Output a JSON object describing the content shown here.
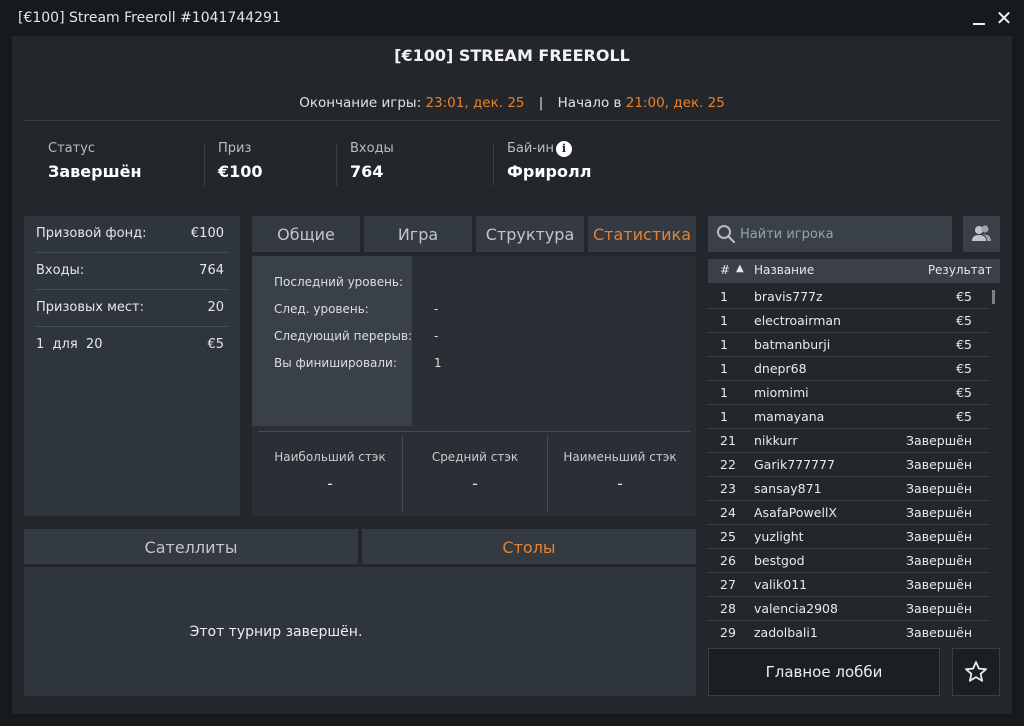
{
  "window": {
    "title": "[€100] Stream Freeroll #1041744291",
    "close": "✕"
  },
  "header": {
    "title": "[€100] STREAM FREEROLL",
    "end_label": "Окончание игры:",
    "end_value": "23:01, дек. 25",
    "separator": "|",
    "start_label": "Начало в",
    "start_value": "21:00, дек. 25"
  },
  "summary": {
    "status_label": "Статус",
    "status_value": "Завершён",
    "prize_label": "Приз",
    "prize_value": "€100",
    "entries_label": "Входы",
    "entries_value": "764",
    "buyin_label": "Бай-ин",
    "buyin_value": "Фриролл",
    "info": "i"
  },
  "prize_panel": {
    "rows": [
      {
        "label": "Призовой фонд:",
        "value": "€100"
      },
      {
        "label": "Входы:",
        "value": "764"
      },
      {
        "label": "Призовых мест:",
        "value": "20"
      }
    ],
    "payout": {
      "label": "1  для  20",
      "value": "€5"
    }
  },
  "tabs": [
    "Общие",
    "Игра",
    "Структура",
    "Статистика"
  ],
  "stats": {
    "lines": [
      {
        "label": "Последний уровень:",
        "value": ""
      },
      {
        "label": "След. уровень:",
        "value": "-"
      },
      {
        "label": "Следующий перерыв:",
        "value": "-"
      },
      {
        "label": "Вы финишировали:",
        "value": "1"
      }
    ],
    "stacks": [
      {
        "label": "Наибольший стэк",
        "value": "-"
      },
      {
        "label": "Средний стэк",
        "value": "-"
      },
      {
        "label": "Наименьший стэк",
        "value": "-"
      }
    ]
  },
  "bottom_tabs": [
    "Сателлиты",
    "Столы"
  ],
  "bottom_message": "Этот турнир завершён.",
  "search": {
    "placeholder": "Найти игрока"
  },
  "players": {
    "headers": {
      "num": "#",
      "sort": "▲",
      "name": "Название",
      "result": "Результат"
    },
    "rows": [
      {
        "pos": "1",
        "name": "bravis777z",
        "result": "€5"
      },
      {
        "pos": "1",
        "name": "electroairman",
        "result": "€5"
      },
      {
        "pos": "1",
        "name": "batmanburji",
        "result": "€5"
      },
      {
        "pos": "1",
        "name": "dnepr68",
        "result": "€5"
      },
      {
        "pos": "1",
        "name": "miomimi",
        "result": "€5"
      },
      {
        "pos": "1",
        "name": "mamayana",
        "result": "€5"
      },
      {
        "pos": "21",
        "name": "nikkurr",
        "result": "Завершён"
      },
      {
        "pos": "22",
        "name": "Garik777777",
        "result": "Завершён"
      },
      {
        "pos": "23",
        "name": "sansay871",
        "result": "Завершён"
      },
      {
        "pos": "24",
        "name": "AsafaPowellX",
        "result": "Завершён"
      },
      {
        "pos": "25",
        "name": "yuzlight",
        "result": "Завершён"
      },
      {
        "pos": "26",
        "name": "bestgod",
        "result": "Завершён"
      },
      {
        "pos": "27",
        "name": "valik011",
        "result": "Завершён"
      },
      {
        "pos": "28",
        "name": "valencia2908",
        "result": "Завершён"
      },
      {
        "pos": "29",
        "name": "zadolbali1",
        "result": "Завершён"
      }
    ]
  },
  "lobby_button": "Главное лобби",
  "colors": {
    "accent": "#e8812e",
    "panel": "#23272c",
    "background": "#16191d"
  }
}
